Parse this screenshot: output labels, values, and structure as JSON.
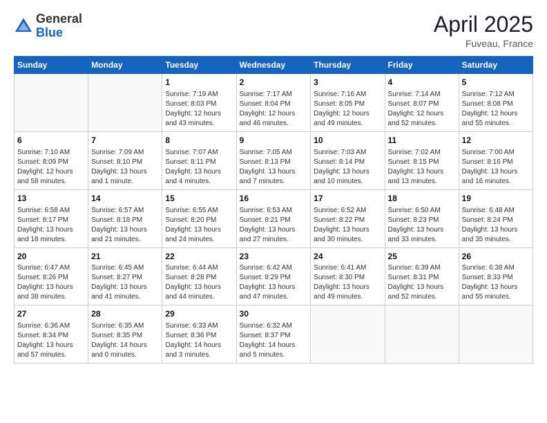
{
  "header": {
    "logo_general": "General",
    "logo_blue": "Blue",
    "month_title": "April 2025",
    "location": "Fuveau, France"
  },
  "weekdays": [
    "Sunday",
    "Monday",
    "Tuesday",
    "Wednesday",
    "Thursday",
    "Friday",
    "Saturday"
  ],
  "weeks": [
    [
      {
        "day": "",
        "info": ""
      },
      {
        "day": "",
        "info": ""
      },
      {
        "day": "1",
        "info": "Sunrise: 7:19 AM\nSunset: 8:03 PM\nDaylight: 12 hours and 43 minutes."
      },
      {
        "day": "2",
        "info": "Sunrise: 7:17 AM\nSunset: 8:04 PM\nDaylight: 12 hours and 46 minutes."
      },
      {
        "day": "3",
        "info": "Sunrise: 7:16 AM\nSunset: 8:05 PM\nDaylight: 12 hours and 49 minutes."
      },
      {
        "day": "4",
        "info": "Sunrise: 7:14 AM\nSunset: 8:07 PM\nDaylight: 12 hours and 52 minutes."
      },
      {
        "day": "5",
        "info": "Sunrise: 7:12 AM\nSunset: 8:08 PM\nDaylight: 12 hours and 55 minutes."
      }
    ],
    [
      {
        "day": "6",
        "info": "Sunrise: 7:10 AM\nSunset: 8:09 PM\nDaylight: 12 hours and 58 minutes."
      },
      {
        "day": "7",
        "info": "Sunrise: 7:09 AM\nSunset: 8:10 PM\nDaylight: 13 hours and 1 minute."
      },
      {
        "day": "8",
        "info": "Sunrise: 7:07 AM\nSunset: 8:11 PM\nDaylight: 13 hours and 4 minutes."
      },
      {
        "day": "9",
        "info": "Sunrise: 7:05 AM\nSunset: 8:13 PM\nDaylight: 13 hours and 7 minutes."
      },
      {
        "day": "10",
        "info": "Sunrise: 7:03 AM\nSunset: 8:14 PM\nDaylight: 13 hours and 10 minutes."
      },
      {
        "day": "11",
        "info": "Sunrise: 7:02 AM\nSunset: 8:15 PM\nDaylight: 13 hours and 13 minutes."
      },
      {
        "day": "12",
        "info": "Sunrise: 7:00 AM\nSunset: 8:16 PM\nDaylight: 13 hours and 16 minutes."
      }
    ],
    [
      {
        "day": "13",
        "info": "Sunrise: 6:58 AM\nSunset: 8:17 PM\nDaylight: 13 hours and 18 minutes."
      },
      {
        "day": "14",
        "info": "Sunrise: 6:57 AM\nSunset: 8:18 PM\nDaylight: 13 hours and 21 minutes."
      },
      {
        "day": "15",
        "info": "Sunrise: 6:55 AM\nSunset: 8:20 PM\nDaylight: 13 hours and 24 minutes."
      },
      {
        "day": "16",
        "info": "Sunrise: 6:53 AM\nSunset: 8:21 PM\nDaylight: 13 hours and 27 minutes."
      },
      {
        "day": "17",
        "info": "Sunrise: 6:52 AM\nSunset: 8:22 PM\nDaylight: 13 hours and 30 minutes."
      },
      {
        "day": "18",
        "info": "Sunrise: 6:50 AM\nSunset: 8:23 PM\nDaylight: 13 hours and 33 minutes."
      },
      {
        "day": "19",
        "info": "Sunrise: 6:48 AM\nSunset: 8:24 PM\nDaylight: 13 hours and 35 minutes."
      }
    ],
    [
      {
        "day": "20",
        "info": "Sunrise: 6:47 AM\nSunset: 8:26 PM\nDaylight: 13 hours and 38 minutes."
      },
      {
        "day": "21",
        "info": "Sunrise: 6:45 AM\nSunset: 8:27 PM\nDaylight: 13 hours and 41 minutes."
      },
      {
        "day": "22",
        "info": "Sunrise: 6:44 AM\nSunset: 8:28 PM\nDaylight: 13 hours and 44 minutes."
      },
      {
        "day": "23",
        "info": "Sunrise: 6:42 AM\nSunset: 8:29 PM\nDaylight: 13 hours and 47 minutes."
      },
      {
        "day": "24",
        "info": "Sunrise: 6:41 AM\nSunset: 8:30 PM\nDaylight: 13 hours and 49 minutes."
      },
      {
        "day": "25",
        "info": "Sunrise: 6:39 AM\nSunset: 8:31 PM\nDaylight: 13 hours and 52 minutes."
      },
      {
        "day": "26",
        "info": "Sunrise: 6:38 AM\nSunset: 8:33 PM\nDaylight: 13 hours and 55 minutes."
      }
    ],
    [
      {
        "day": "27",
        "info": "Sunrise: 6:36 AM\nSunset: 8:34 PM\nDaylight: 13 hours and 57 minutes."
      },
      {
        "day": "28",
        "info": "Sunrise: 6:35 AM\nSunset: 8:35 PM\nDaylight: 14 hours and 0 minutes."
      },
      {
        "day": "29",
        "info": "Sunrise: 6:33 AM\nSunset: 8:36 PM\nDaylight: 14 hours and 3 minutes."
      },
      {
        "day": "30",
        "info": "Sunrise: 6:32 AM\nSunset: 8:37 PM\nDaylight: 14 hours and 5 minutes."
      },
      {
        "day": "",
        "info": ""
      },
      {
        "day": "",
        "info": ""
      },
      {
        "day": "",
        "info": ""
      }
    ]
  ]
}
